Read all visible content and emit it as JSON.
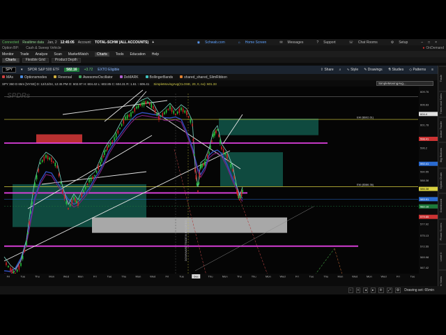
{
  "topbar": {
    "connection": "Connected",
    "realtime": "Realtime data",
    "date": "Jan, 2",
    "time": "12:45:05",
    "account_label": "Account:",
    "account": "TOTAL-SCHW (ALL ACCOUNTS)",
    "plus": "+",
    "right": {
      "schwab": "Schwab.com",
      "home": "Home Screen",
      "messages": "Messages",
      "support": "Support",
      "chat": "Chat Rooms",
      "setup": "Setup",
      "ondemand": "OnDemand"
    }
  },
  "optbar": {
    "option_bp": "Option BP:",
    "cash_sweep": "Cash & Sweep Vehicle"
  },
  "menu": [
    "Monitor",
    "Trade",
    "Analyze",
    "Scan",
    "MarketWatch",
    "Charts",
    "Tools",
    "Education",
    "Help"
  ],
  "menu_active": "Charts",
  "tabs": [
    "Charts",
    "Flexible Grid",
    "Product Depth"
  ],
  "toolbar": {
    "symbol": "SPY",
    "description": "SPDR S&P 500 ETF",
    "price": "582.16",
    "change": "+3.72",
    "link": "EXTO Eligible",
    "share": "Share",
    "style": "Style",
    "drawings": "Drawings",
    "studies": "Studies",
    "patterns": "Patterns"
  },
  "studies": [
    "MAs",
    "Optionsmodes",
    "Reversal",
    "AwesomeOscillator",
    "DeMARK",
    "BollingerBands",
    "shared_shared_SlimRibbon"
  ],
  "study_colors": [
    "#d04040",
    "#4c8be0",
    "#d0b040",
    "#40a060",
    "#b060d0",
    "#40c0c0",
    "#e08030"
  ],
  "infobar": {
    "text": "SPY 360 D 65m [NYSE]   D: 12/13/24, 12:45 PM   O: 602.97   H: 604.42   L: 602.85   C: 604.31   R: 1.61   ↑ 606.41",
    "ma_text": "SimpleMovingAvg(CLOSE, 20, 0, no): 601.33",
    "search": "SimpleMovingAvg..."
  },
  "chart_labels": {
    "ema1": "EM ($602.61)",
    "ema2": "EM ($586.36)",
    "sidebar_note": "DOWNWARD TRADE IN PROGRESS",
    "watermark": "SPDRs"
  },
  "price_axis": [
    {
      "label": "609.76",
      "value": 609.76
    },
    {
      "label": "606.63",
      "value": 606.63
    },
    {
      "label": "604.4",
      "value": 604.4
    },
    {
      "label": "601.78",
      "value": 601.78
    },
    {
      "label": "598.41",
      "value": 598.41
    },
    {
      "label": "596.2",
      "value": 596.2
    },
    {
      "label": "592.41",
      "value": 592.41
    },
    {
      "label": "590.55",
      "value": 590.55
    },
    {
      "label": "588.38",
      "value": 588.38
    },
    {
      "label": "586.35",
      "value": 586.35
    },
    {
      "label": "583.91",
      "value": 583.91
    },
    {
      "label": "582.16",
      "value": 582.16
    },
    {
      "label": "579.65",
      "value": 579.65
    },
    {
      "label": "577.92",
      "value": 577.92
    },
    {
      "label": "575.13",
      "value": 575.13
    },
    {
      "label": "572.55",
      "value": 572.55
    },
    {
      "label": "569.98",
      "value": 569.98
    },
    {
      "label": "567.42",
      "value": 567.42
    }
  ],
  "price_badges": [
    {
      "label": "604.4",
      "value": 604.4,
      "color": "#e0e0e0",
      "text": "#000"
    },
    {
      "label": "598.41",
      "value": 598.41,
      "color": "#cc3333",
      "text": "#fff"
    },
    {
      "label": "592.41",
      "value": 592.41,
      "color": "#2a6bd1",
      "text": "#fff"
    },
    {
      "label": "586.38",
      "value": 586.38,
      "color": "#d8d040",
      "text": "#000"
    },
    {
      "label": "583.91",
      "value": 583.91,
      "color": "#2a6bd1",
      "text": "#fff"
    },
    {
      "label": "582.16",
      "value": 582.16,
      "color": "#1c7a3a",
      "text": "#fff"
    },
    {
      "label": "579.65",
      "value": 579.65,
      "color": "#cc3333",
      "text": "#fff"
    }
  ],
  "time_axis": [
    "Fri",
    "Tue",
    "Thu",
    "Mon",
    "Wed",
    "Mon",
    "Fri",
    "Tue",
    "Thu",
    "Mon",
    "Wed",
    "Fri",
    "Tue",
    "Dec",
    "Thu",
    "Mon",
    "Thu",
    "Thu",
    "Mon",
    "Wed",
    "Fri",
    "Tue",
    "Thu",
    "Mon",
    "Wed",
    "Mon",
    "Wed",
    "Fri",
    "Tue"
  ],
  "time_highlight": "Dec",
  "sidebar_tabs": [
    "Trade",
    "Times and Sales",
    "Active Trader",
    "Big Buttons",
    "Option Chain",
    "Dashboard",
    "Phase Scores",
    "Level II",
    "Live News"
  ],
  "status": {
    "drawing_set": "Drawing set: 65min"
  },
  "colors": {
    "magenta": "#e040e0",
    "yellow": "#d8d040",
    "teal_zone": "#0f4a3f",
    "gray_zone": "#a8a8a8",
    "red_zone": "#b83030",
    "candle_up": "#27c43a",
    "candle_down": "#cc2222"
  }
}
